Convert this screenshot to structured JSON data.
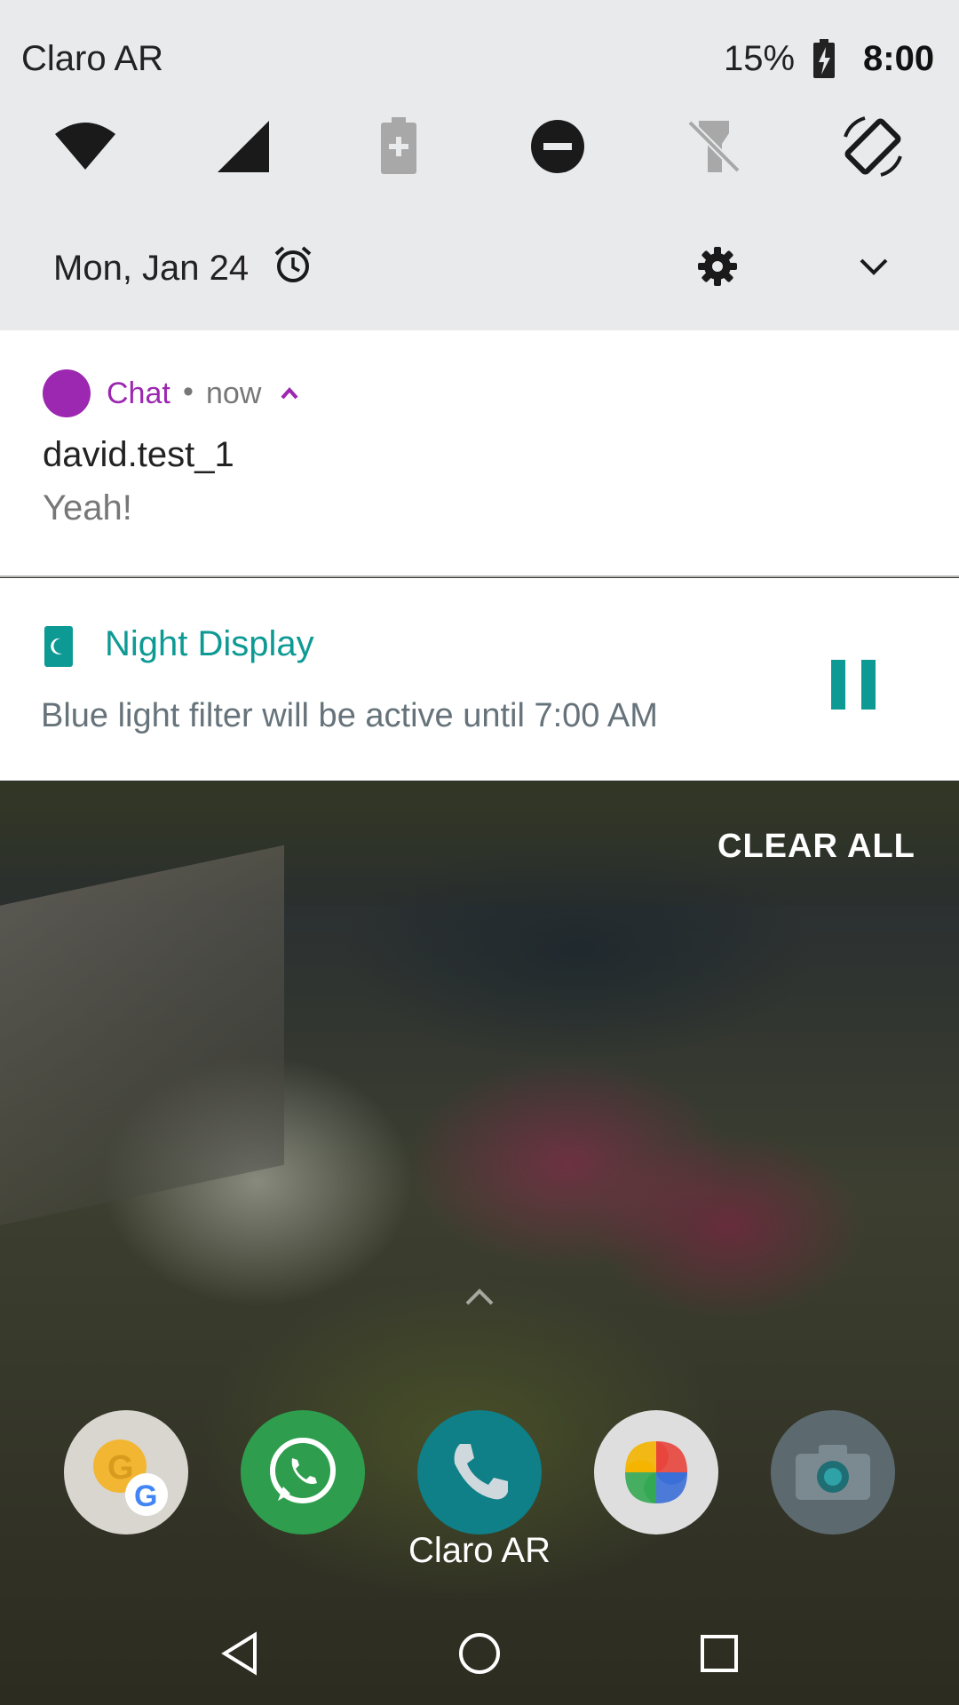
{
  "status_bar": {
    "carrier": "Claro AR",
    "battery_percent": "15%",
    "time": "8:00"
  },
  "quick_settings": {
    "tiles": [
      "wifi-icon",
      "cell-signal-icon",
      "battery-saver-icon",
      "do-not-disturb-icon",
      "flashlight-off-icon",
      "auto-rotate-icon"
    ],
    "date": "Mon, Jan 24"
  },
  "notifications": {
    "chat": {
      "app_name": "Chat",
      "separator": "•",
      "time": "now",
      "sender": "david.test_1",
      "message": "Yeah!",
      "accent": "#9c27b0"
    },
    "night_display": {
      "title": "Night Display",
      "body": "Blue light filter will be active until 7:00 AM",
      "accent": "#0e9a94"
    },
    "clear_all_label": "CLEAR ALL"
  },
  "dock": {
    "apps": [
      "weather-app-icon",
      "whatsapp-icon",
      "phone-icon",
      "photos-icon",
      "camera-icon"
    ],
    "label": "Claro AR"
  },
  "nav_bar": {
    "buttons": [
      "back-icon",
      "home-icon",
      "recents-icon"
    ]
  }
}
